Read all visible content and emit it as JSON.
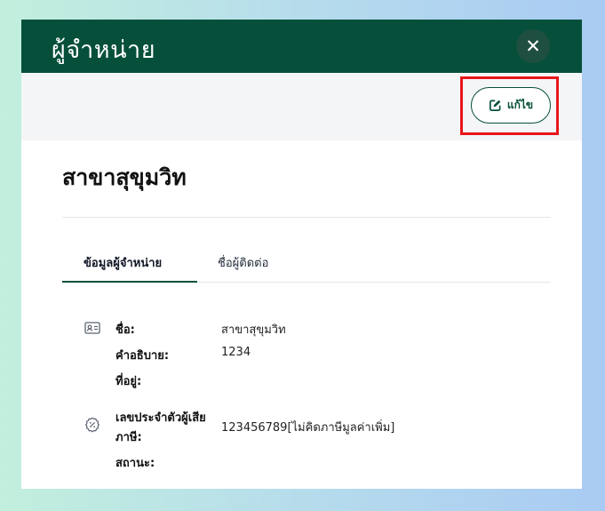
{
  "modal": {
    "title": "ผู้จำหน่าย",
    "close_glyph": "✕",
    "edit_label": "แก้ไข",
    "branch_name": "สาขาสุขุมวิท"
  },
  "tabs": [
    {
      "label": "ข้อมูลผู้จำหน่าย",
      "active": true
    },
    {
      "label": "ชื่อผู้ติดต่อ",
      "active": false
    }
  ],
  "info": {
    "name_label": "ชื่อ:",
    "name_value": "สาขาสุขุมวิท",
    "description_label": "คำอธิบาย:",
    "description_value": "1234",
    "address_label": "ที่อยู่:",
    "address_value": "",
    "taxid_label_line1": "เลขประจำตัวผู้เสีย",
    "taxid_label_line2": "ภาษี:",
    "taxid_value": "123456789[ไม่คิดภาษีมูลค่าเพิ่ม]",
    "status_label": "สถานะ:",
    "status_value": ""
  },
  "icons": {
    "close": "close-icon",
    "edit": "edit-icon",
    "id_card": "id-card-icon",
    "percent": "percent-badge-icon"
  },
  "colors": {
    "header_bg": "#06503b",
    "accent": "#06503b",
    "highlight": "#e8161b",
    "toolbar_bg": "#f4f5f7"
  }
}
